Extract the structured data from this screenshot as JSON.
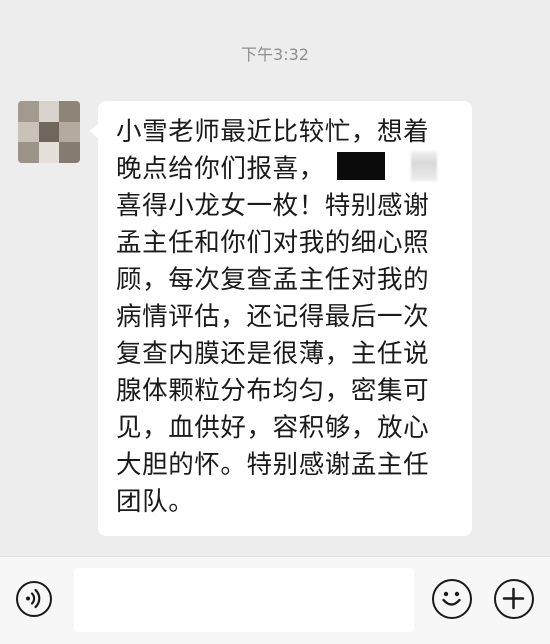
{
  "chat": {
    "timestamp": "下午3:32",
    "message": {
      "lines": [
        "小雪老师最近比较忙，想着",
        "晚点给你们报喜，",
        "喜得小龙女一枚！特别感谢",
        "孟主任和你们对我的细心照",
        "顾，每次复查孟主任对我的",
        "病情评估，还记得最后一次",
        "复查内膜还是很薄，主任说",
        "腺体颗粒分布均匀，密集可",
        "见，血供好，容积够，放心",
        "大胆的怀。特别感谢孟主任",
        "团队。"
      ]
    }
  },
  "input_bar": {
    "text_value": "",
    "icons": {
      "voice": "voice-icon",
      "emoji": "emoji-icon",
      "more": "plus-icon"
    }
  },
  "colors": {
    "background": "#ededed",
    "bubble": "#ffffff",
    "text": "#1a1a1a",
    "timestamp": "#8f8f8f"
  }
}
